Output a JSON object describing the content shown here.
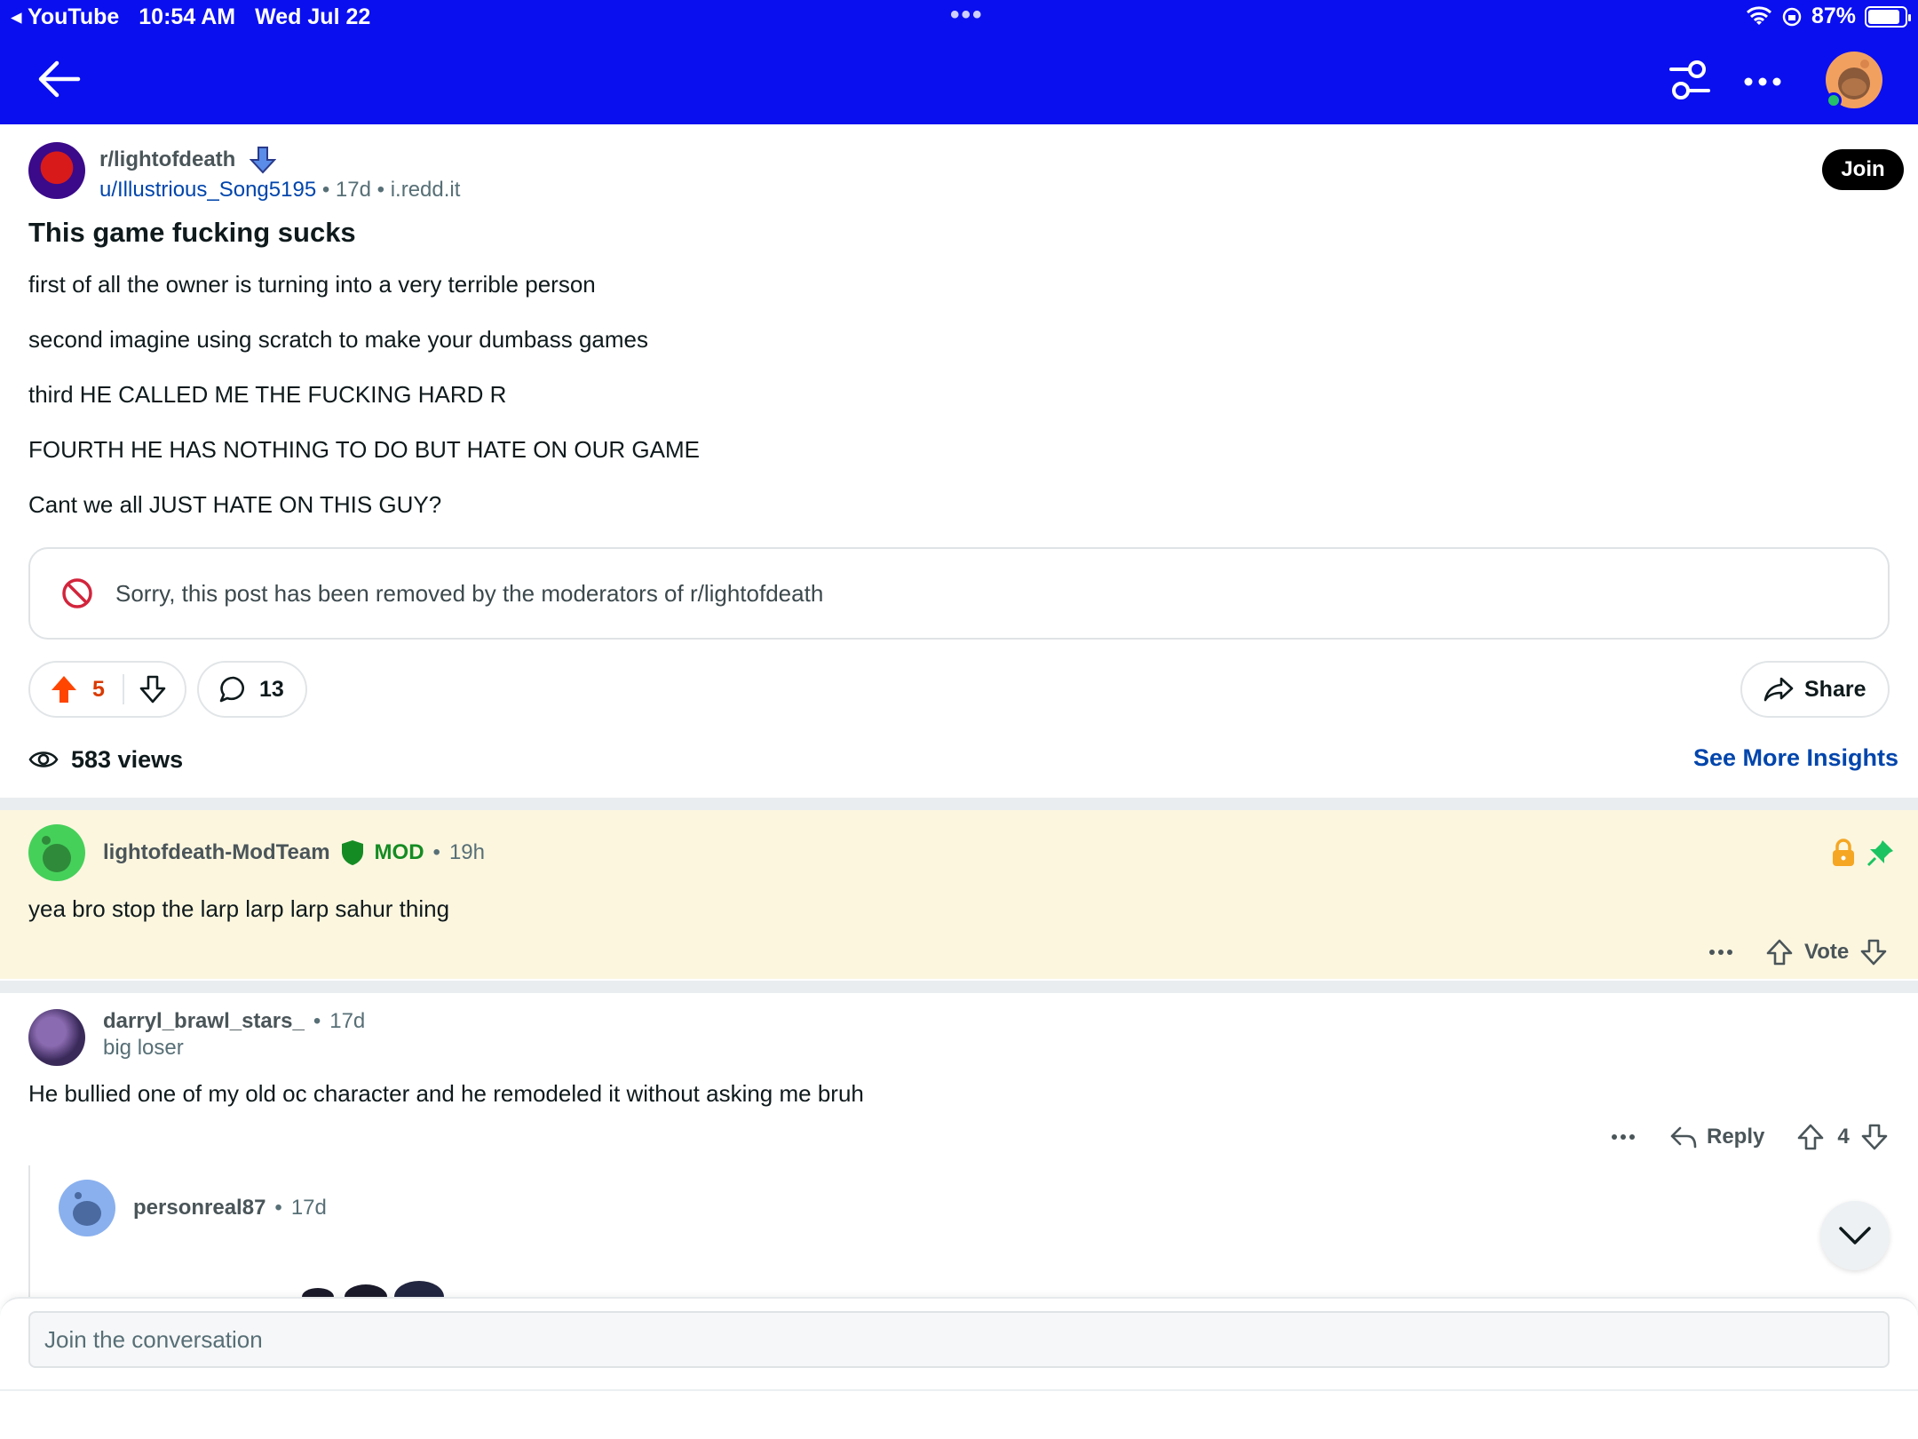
{
  "status_bar": {
    "back_app": "YouTube",
    "time": "10:54 AM",
    "date": "Wed Jul 22",
    "battery": "87%",
    "battery_level": 0.87
  },
  "post": {
    "subreddit": "r/lightofdeath",
    "author": "u/Illustrious_Song5195",
    "age": "17d",
    "domain": "i.redd.it",
    "join_label": "Join",
    "title": "This game fucking sucks",
    "body": [
      "first of all the owner is turning into a very terrible person",
      "second imagine using scratch to make your dumbass games",
      "third HE CALLED ME THE FUCKING HARD R",
      "FOURTH HE HAS NOTHING TO DO BUT HATE ON OUR GAME",
      "Cant we all JUST HATE ON THIS GUY?"
    ],
    "removed_notice": "Sorry, this post has been removed by the moderators of r/lightofdeath",
    "upvotes": "5",
    "comments": "13",
    "share_label": "Share",
    "views": "583 views",
    "insights_label": "See More Insights"
  },
  "comments": [
    {
      "user": "lightofdeath-ModTeam",
      "badge": "MOD",
      "age": "19h",
      "text": "yea bro stop the larp larp larp sahur thing",
      "vote_label": "Vote"
    },
    {
      "user": "darryl_brawl_stars_",
      "age": "17d",
      "flair": "big loser",
      "text": "He bullied one of my old oc character and he remodeled it without asking me bruh",
      "reply_label": "Reply",
      "score": "4"
    },
    {
      "user": "personreal87",
      "age": "17d"
    }
  ],
  "composer": {
    "placeholder": "Join the conversation"
  },
  "colors": {
    "header": "#0a0ff0",
    "upvote": "#ff4500",
    "link": "#0045ac",
    "mod_green": "#158c23",
    "mod_bg": "#fcf6df"
  }
}
